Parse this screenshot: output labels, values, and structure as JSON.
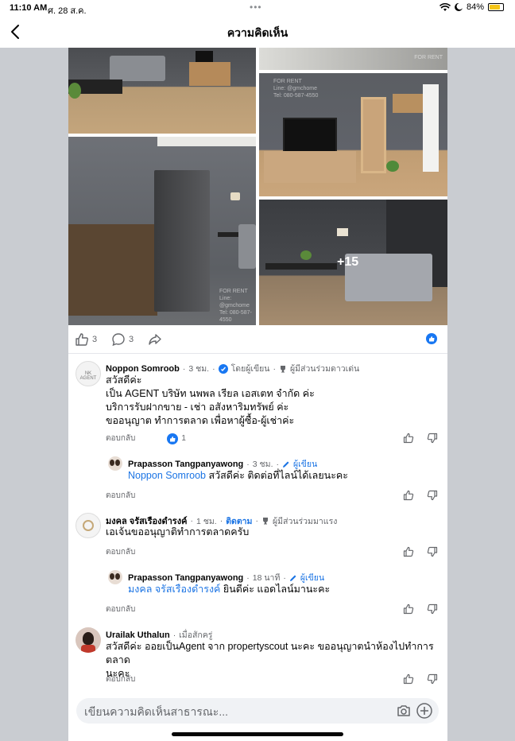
{
  "status_bar": {
    "time": "11:10 AM",
    "date": "ศ. 28 ส.ค.",
    "battery": "84%",
    "battery_level": 0.84
  },
  "header": {
    "title": "ความคิดเห็น"
  },
  "post": {
    "photos": {
      "more_count": "+15"
    },
    "watermark": {
      "line1": "FOR RENT",
      "line2": "Line: @gmchome",
      "line3": "Tel: 080-587-4550"
    },
    "like_count": "3",
    "comment_count": "3"
  },
  "comments": [
    {
      "name": "Noppon Somroob",
      "time": "3 ชม.",
      "tag": "โดยผู้เขียน",
      "badge": "ผู้มีส่วนร่วมดาวเด่น",
      "avatar_text": "NK AGENT",
      "lines": [
        "สวัสดีค่ะ",
        "เป็น AGENT บริษัท นพพล เรียล เอสเตท จำกัด ค่ะ",
        "บริการรับฝากขาย - เช่า อสังหาริมทรัพย์ ค่ะ",
        "ขออนุญาต ทำการตลาด เพื่อหาผู้ซื้อ-ผู้เช่าค่ะ"
      ],
      "reply_label": "ตอบกลับ",
      "reaction_count": "1"
    },
    {
      "name": "Prapasson Tangpanyawong",
      "time": "3 ชม.",
      "tag": "ผู้เขียน",
      "mention": "Noppon Somroob",
      "text": " สวัสดีค่ะ ติดต่อที่ไลน์ได้เลยนะคะ",
      "reply_label": "ตอบกลับ"
    },
    {
      "name": "มงคล จรัสเรืองดำรงค์",
      "time": "1 ชม.",
      "follow": "ติดตาม",
      "badge": "ผู้มีส่วนร่วมมาแรง",
      "text": "เอเจ้นขออนุญาติทำการตลาดครับ",
      "reply_label": "ตอบกลับ"
    },
    {
      "name": "Prapasson Tangpanyawong",
      "time": "18 นาที",
      "tag": "ผู้เขียน",
      "mention": "มงคล จรัสเรืองดำรงค์",
      "text": " ยินดีค่ะ แอดไลน์มานะคะ",
      "reply_label": "ตอบกลับ"
    },
    {
      "name": "Urailak Uthalun",
      "time": "เมื่อสักครู่",
      "lines": [
        "สวัสดีค่ะ ออยเป็นAgent จาก propertyscout นะคะ ขออนุญาตนำห้องไปทำการตลาด",
        "นะคะ"
      ],
      "reply_label": "ตอบกลับ"
    }
  ],
  "composer": {
    "placeholder": "เขียนความคิดเห็นสาธารณะ..."
  }
}
